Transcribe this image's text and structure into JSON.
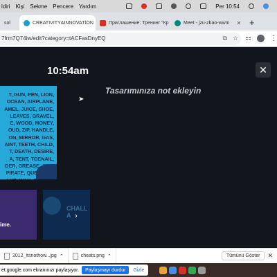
{
  "menubar": {
    "items": [
      "ldiri",
      "Kişi",
      "Sekme",
      "Pencere",
      "Yardım"
    ],
    "clock": "Per 10:54"
  },
  "tabs": [
    {
      "label": "sol",
      "active": false,
      "color": "#8e8e8e"
    },
    {
      "label": "CREATIVITY&INNOVATION",
      "active": true,
      "color": "#1a9cd8"
    },
    {
      "label": "Приглашение: Тренинг \"Кр",
      "active": false,
      "color": "#d93025"
    },
    {
      "label": "Meet - jzu-zbao-wwm",
      "active": false,
      "color": "#00897b"
    }
  ],
  "address": {
    "url": "7frm7Q74iw/edit?category=tACFasDnyEQ"
  },
  "editor": {
    "time": "10:54am",
    "note_placeholder": "Tasarımınıza not ekleyin",
    "slide1_words": "T, GUN, PEN, LION,\nOCEAN, AIRPLANE,\nAMEL, JUICE, SHOE,\nLEAVES, GRAVEL,\nE, WOOD, MONEY,\nOUD, ZIP, HANDLE,\nON, MIRROR, GAS,\nAINT, TEETH, CHILD,\nT, DEATH, DESIRE,\nA, TENT, TOENAIL,\nDER, GREASE, JAM,\nPIRATE, QUESTION,\nLUE, WAX, SCREEN",
    "slide2_text": "ime.",
    "slide3_text": "CHALL\nA"
  },
  "downloads": [
    {
      "name": "2012_itsnothow...jpg"
    },
    {
      "name": "cheats.png"
    }
  ],
  "downloads_show_all": "Tümünü Göster",
  "share": {
    "message": "et.google.com ekranınızı paylaşıyor.",
    "stop": "Paylaşmayı durdur",
    "hide": "Gizle"
  }
}
